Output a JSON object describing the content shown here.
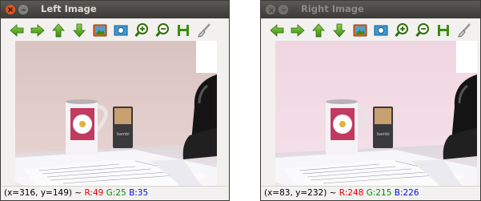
{
  "windows": [
    {
      "title": "Left Image",
      "active": true,
      "status": {
        "coords": "(x=316, y=149) ~ ",
        "r": "R:49",
        "g": "G:25",
        "b": "B:35"
      }
    },
    {
      "title": "Right Image",
      "active": false,
      "status": {
        "coords": "(x=83, y=232) ~ ",
        "r": "R:248",
        "g": "G:215",
        "b": "B:226"
      }
    }
  ],
  "toolbar_icons": [
    "arrow-left-icon",
    "arrow-right-icon",
    "arrow-up-icon",
    "arrow-down-icon",
    "picture-icon",
    "zoom-fit-icon",
    "zoom-in-icon",
    "zoom-out-icon",
    "save-icon",
    "properties-brush-icon"
  ],
  "colors": {
    "rgb_red": "#e00000",
    "rgb_green": "#009000",
    "rgb_blue": "#0010e0",
    "close_active": "#e0531e"
  },
  "scene": {
    "mug_label": "",
    "sharpener_label": "bambi"
  }
}
